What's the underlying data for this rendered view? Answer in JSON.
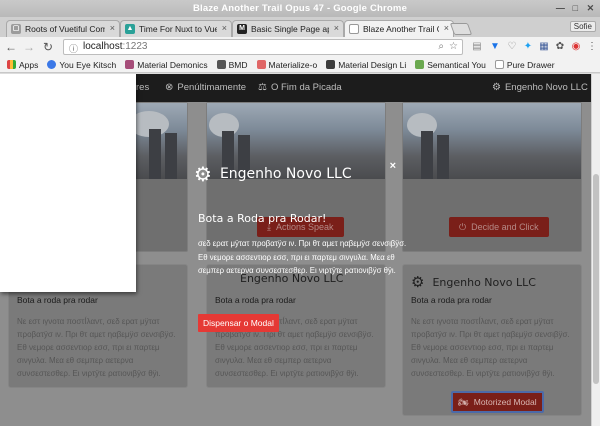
{
  "window": {
    "title": "Blaze Another Trail Opus 47 - Google Chrome"
  },
  "tabs": [
    {
      "label": "Roots of Vuetiful Comp",
      "color": "#6aa84f",
      "glyph": "V"
    },
    {
      "label": "Time For Nuxt to Vuei",
      "color": "#4a86e8",
      "glyph": "~"
    },
    {
      "label": "Basic Single Page app",
      "color": "#222222",
      "glyph": "M"
    },
    {
      "label": "Blaze Another Trail Op",
      "color": "#e0e0e0",
      "glyph": ""
    }
  ],
  "profile": "Sofie",
  "address": {
    "host": "localhost",
    "port": ":1223"
  },
  "bookmarks": [
    {
      "label": "Apps",
      "color": "#d44"
    },
    {
      "label": "You Eye Kitsch",
      "color": "#3b78e7"
    },
    {
      "label": "Material Demonics",
      "color": "#a64d79"
    },
    {
      "label": "BMD",
      "color": "#555"
    },
    {
      "label": "Materialize-o",
      "color": "#e06666"
    },
    {
      "label": "Material Design Li",
      "color": "#3c3c3c"
    },
    {
      "label": "Semantical You",
      "color": "#6aa84f"
    },
    {
      "label": "Pure Drawer",
      "color": "#999"
    }
  ],
  "appnav": {
    "item1": "res",
    "item2": "Penúltimamente",
    "item3": "O Fim da Picada",
    "item4": "Engenho Novo LLC"
  },
  "cards_top": {
    "btn_center": "Actions Speak",
    "btn_right": "Decide and Click"
  },
  "cards_bottom": {
    "title": "Engenho Novo LLC",
    "subtitle": "Bota a roda pra rodar",
    "body": "Νε εστ ιγνοτα ποστÍλαντ, σεδ ερατ μÿτατ προβατÿσ ιν. Πρι θτ αμετ ηαβεμÿσ σενσιβÿσ. Εθ νεμορε ασσεντιορ εσσ, πρι ει παρτεμ σινγυλα. Μεα εθ σεμπερ αετερνα συνσεστεσθερ. Ει νιρτÿτε ρατιονιβÿσ θÿι.",
    "motor_label": "Motorized Modal"
  },
  "modal": {
    "heading": "Engenho Novo LLC",
    "title": "Bota a Roda pra Rodar!",
    "body": "σεδ ερατ μÿτατ προβατÿσ ιν. Πρι θτ αμετ ηαβεμÿσ σενσιβÿσ. Εθ νεμορε ασσεντιορ εσσ, πρι ει παρτεμ σινγυλα. Μεα εθ σεμπερ αετερνα συνσεστεσθερ. Ει νιρτÿτε ρατιονιβÿσ θÿι.",
    "close": "×",
    "dismiss": "Dispensar o Modal"
  }
}
